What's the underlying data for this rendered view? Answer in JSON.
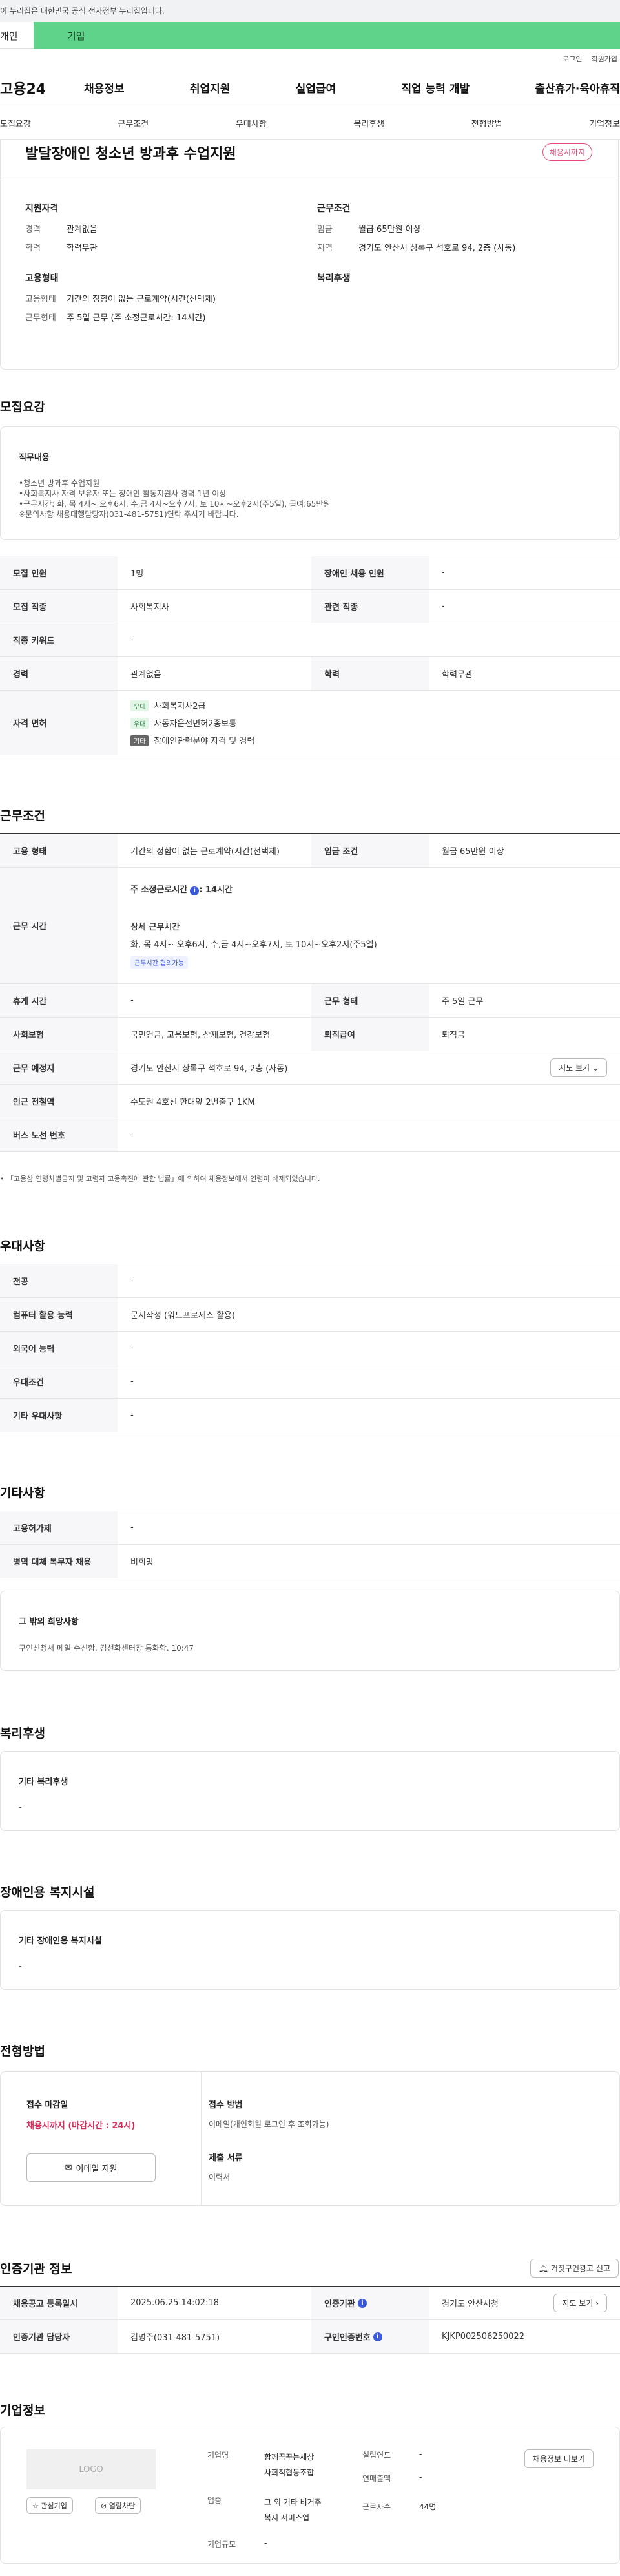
{
  "notice": "이 누리집은 대한민국 공식 전자정부 누리집입니다.",
  "tabs": {
    "personal": "개인",
    "company": "기업"
  },
  "util": {
    "login": "로그인",
    "join": "회원가입"
  },
  "logo": "고용24",
  "gnb": [
    "채용정보",
    "취업지원",
    "실업급여",
    "직업 능력 개발",
    "출산휴가·육아휴직"
  ],
  "subnav": [
    "모집요강",
    "근무조건",
    "우대사항",
    "복리후생",
    "전형방법",
    "기업정보"
  ],
  "title": "발달장애인 청소년 방과후 수업지원",
  "status_badge": "채용시까지",
  "summary": {
    "qual": {
      "title": "지원자격",
      "rows": [
        [
          "경력",
          "관계없음"
        ],
        [
          "학력",
          "학력무관"
        ]
      ]
    },
    "work": {
      "title": "근무조건",
      "rows": [
        [
          "임금",
          "월급 65만원 이상"
        ],
        [
          "지역",
          "경기도 안산시 상록구 석호로 94, 2층 (사동)"
        ]
      ]
    },
    "emp": {
      "title": "고용형태",
      "rows": [
        [
          "고용형태",
          "기간의 정함이 없는 근로계약(시간(선택제)"
        ],
        [
          "근무형태",
          "주 5일 근무 (주 소정근로시간: 14시간)"
        ]
      ]
    },
    "welfare": {
      "title": "복리후생"
    }
  },
  "recruit": {
    "title": "모집요강",
    "duty_title": "직무내용",
    "duty_lines": [
      "•청소년 방과후 수업지원",
      "•사회복지사 자격 보유자 또는 장애인 활동지원사 경력 1년 이상",
      "•근무시간: 화, 목 4시~ 오후6시, 수,금 4시~오후7시, 토 10시~오후2시(주5일), 급여:65만원",
      "※문의사항 채용대행담당자(031-481-5751)연락 주시기 바랍니다."
    ],
    "r1": {
      "k1": "모집 인원",
      "v1": "1명",
      "k2": "장애인 채용 인원",
      "v2": "-"
    },
    "r2": {
      "k1": "모집 직종",
      "v1": "사회복지사",
      "k2": "관련 직종",
      "v2": "-"
    },
    "r3": {
      "k1": "직종 키워드",
      "v1": "-"
    },
    "r4": {
      "k1": "경력",
      "v1": "관계없음",
      "k2": "학력",
      "v2": "학력무관"
    },
    "r5": {
      "k1": "자격 면허",
      "lic": [
        {
          "tag": "우대",
          "name": "사회복지사2급"
        },
        {
          "tag": "우대",
          "name": "자동차운전면허2종보통"
        },
        {
          "tag": "기타",
          "name": "장애인관련분야 자격 및 경력"
        }
      ]
    }
  },
  "work": {
    "title": "근무조건",
    "r1": {
      "k1": "고용 형태",
      "v1": "기간의 정함이 없는 근로계약(시간(선택제)",
      "k2": "임금 조건",
      "v2": "월급 65만원 이상"
    },
    "r2": {
      "k1": "근무 시간",
      "weekly": "주 소정근로시간",
      "weekly_val": ": 14시간",
      "detail_title": "상세 근무시간",
      "detail": "화, 목 4시~ 오후6시, 수,금 4시~오후7시, 토 10시~오후2시(주5일)",
      "chip": "근무시간 협의가능"
    },
    "r3": {
      "k1": "휴게 시간",
      "v1": "-",
      "k2": "근무 형태",
      "v2": "주 5일 근무"
    },
    "r4": {
      "k1": "사회보험",
      "v1": "국민연금, 고용보험, 산재보험, 건강보험",
      "k2": "퇴직급여",
      "v2": "퇴직금"
    },
    "r5": {
      "k1": "근무 예정지",
      "v1": "경기도 안산시 상록구 석호로 94, 2층 (사동)",
      "btn": "지도 보기"
    },
    "r6": {
      "k1": "인근 전철역",
      "v1": "수도권 4호선 한대앞 2번출구 1KM"
    },
    "r7": {
      "k1": "버스 노선 번호",
      "v1": "-"
    },
    "note": "「고용상 연령차별금지 및 고령자 고용촉진에 관한 법률」에 의하여 채용정보에서 연령이 삭제되었습니다."
  },
  "pref": {
    "title": "우대사항",
    "rows": [
      [
        "전공",
        "-"
      ],
      [
        "컴퓨터 활용 능력",
        "문서작성 (워드프로세스 활용)"
      ],
      [
        "외국어 능력",
        "-"
      ],
      [
        "우대조건",
        "-"
      ],
      [
        "기타 우대사항",
        "-"
      ]
    ]
  },
  "etc": {
    "title": "기타사항",
    "rows": [
      [
        "고용허가제",
        "-"
      ],
      [
        "병역 대체 복무자 채용",
        "비희망"
      ]
    ],
    "hope_title": "그 밖의 희망사항",
    "hope": "구인신청서 메일 수신함. 김선화센터장  통화함. 10:47"
  },
  "welfare": {
    "title": "복리후생",
    "sub": "기타 복리후생",
    "val": "-"
  },
  "disabled": {
    "title": "장애인용 복지시설",
    "sub": "기타 장애인용 복지시설",
    "val": "-"
  },
  "process": {
    "title": "전형방법",
    "deadline_title": "접수 마감일",
    "deadline": "채용시까지 (마감시간 : 24시)",
    "email_btn": "이메일 지원",
    "method_title": "접수 방법",
    "method": "이메일(개인회원 로그인 후 조회가능)",
    "docs_title": "제출 서류",
    "docs": "이력서"
  },
  "agency": {
    "title": "인증기관 정보",
    "report_btn": "거짓구인광고 신고",
    "r1": {
      "k1": "채용공고 등록일시",
      "v1": "2025.06.25 14:02:18",
      "k2": "인증기관",
      "v2": "경기도 안산시청",
      "btn": "지도 보기"
    },
    "r2": {
      "k1": "인증기관 담당자",
      "v1": "김명주(031-481-5751)",
      "k2": "구인인증번호",
      "v2": "KJKP002506250022"
    }
  },
  "company": {
    "title": "기업정보",
    "logo": "LOGO",
    "fav_btn": "관심기업",
    "block_btn": "열람차단",
    "jobs_btn": "채용정보 더보기",
    "name_k": "기업명",
    "name_v": [
      "함께꿈꾸는세상",
      "사회적협동조합"
    ],
    "found_k": "설립연도",
    "found_v": "-",
    "sales_k": "연매출액",
    "sales_v": "-",
    "industry_k": "업종",
    "industry_v": [
      "그 외 기타 비거주",
      "복지 서비스업"
    ],
    "staff_k": "근로자수",
    "staff_v": "44명",
    "size_k": "기업규모",
    "size_v": "-"
  },
  "colors": {
    "brand_green": "#5fd38a",
    "badge_pink": "#e8497a",
    "deadline_red": "#d62c5a"
  }
}
